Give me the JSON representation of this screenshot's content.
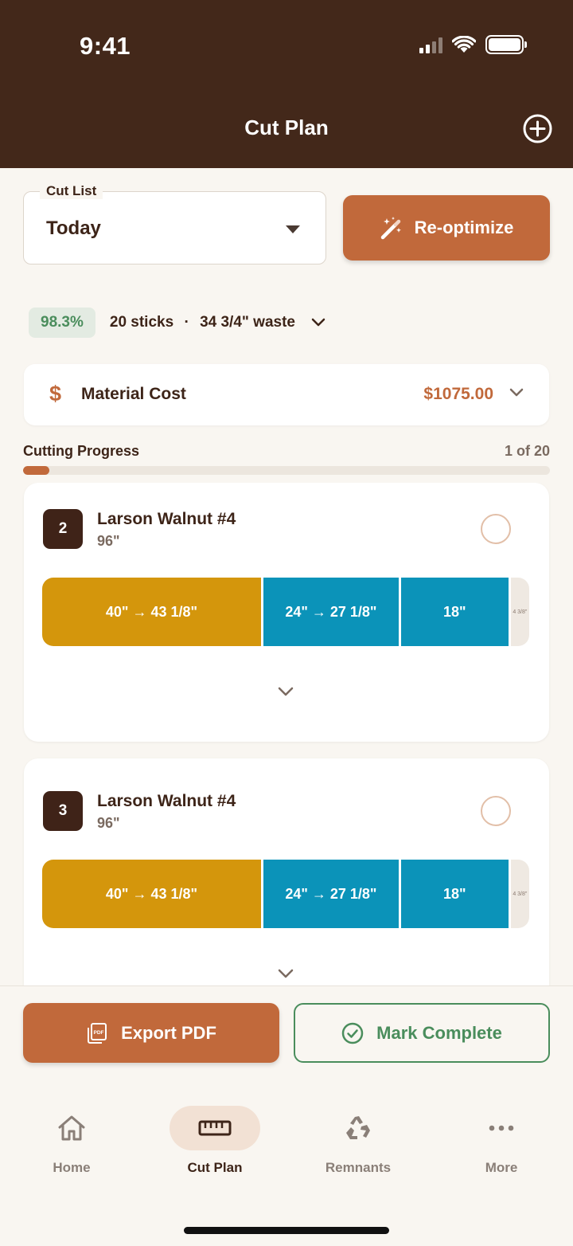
{
  "status_bar": {
    "time": "9:41"
  },
  "header": {
    "title": "Cut Plan"
  },
  "cut_list": {
    "label": "Cut List",
    "value": "Today"
  },
  "reoptimize": {
    "label": "Re-optimize"
  },
  "summary": {
    "yield_pct": "98.3%",
    "sticks": "20 sticks",
    "separator": "·",
    "waste": "34 3/4\" waste"
  },
  "material_cost": {
    "symbol": "$",
    "label": "Material Cost",
    "value": "$1075.00"
  },
  "progress": {
    "label": "Cutting Progress",
    "count": "1 of 20",
    "fraction": 0.05
  },
  "sticks": [
    {
      "number": "2",
      "name": "Larson Walnut #4",
      "length": "96\"",
      "segments": [
        {
          "label": "40\" → 43 1/8\"",
          "inches": 43.125,
          "color": "#d4960c"
        },
        {
          "label": "24\" → 27 1/8\"",
          "inches": 27.125,
          "color": "#0b93b9"
        },
        {
          "label": "18\"",
          "inches": 21.625,
          "color": "#0b93b9"
        },
        {
          "label": "4 3/8\"",
          "inches": 4.125,
          "color": "#efe9e2",
          "waste": true
        }
      ]
    },
    {
      "number": "3",
      "name": "Larson Walnut #4",
      "length": "96\"",
      "segments": [
        {
          "label": "40\" → 43 1/8\"",
          "inches": 43.125,
          "color": "#d4960c"
        },
        {
          "label": "24\" → 27 1/8\"",
          "inches": 27.125,
          "color": "#0b93b9"
        },
        {
          "label": "18\"",
          "inches": 21.625,
          "color": "#0b93b9"
        },
        {
          "label": "4 3/8\"",
          "inches": 4.125,
          "color": "#efe9e2",
          "waste": true
        }
      ]
    }
  ],
  "actions": {
    "export": "Export PDF",
    "complete": "Mark Complete"
  },
  "tabs": [
    {
      "label": "Home",
      "icon": "home-icon"
    },
    {
      "label": "Cut Plan",
      "icon": "ruler-icon",
      "active": true
    },
    {
      "label": "Remnants",
      "icon": "recycle-icon"
    },
    {
      "label": "More",
      "icon": "more-icon"
    }
  ],
  "colors": {
    "header": "#43281a",
    "accent": "#c1693b",
    "success": "#4a8d5c",
    "primary_cut": "#d4960c",
    "secondary_cut": "#0b93b9"
  }
}
